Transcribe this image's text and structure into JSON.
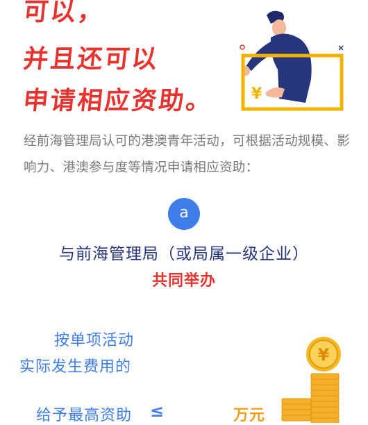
{
  "headline": {
    "line1": "可以，",
    "line2": "并且还可以",
    "line3": "申请相应资助。"
  },
  "intro": "经前海管理局认可的港澳青年活动，可根据活动规模、影响力、港澳参与度等情况申请相应资助：",
  "item_badge": "a",
  "organizers": "与前海管理局（或局属一级企业）",
  "cohost": "共同举办",
  "funding": {
    "line1": "按单项活动",
    "line2": "实际发生费用的",
    "line3": "给予最高资助",
    "symbol": "≤",
    "unit": "万元"
  },
  "icons": {
    "hero": "person-holding-yuan-card-illustration",
    "coins": "gold-yuan-coin-stack-icon",
    "card_symbol": "¥"
  },
  "colors": {
    "red": "#e8322d",
    "blue": "#3f7ee8",
    "navy": "#27357a",
    "gold": "#f0a020",
    "gray": "#7a7a7a"
  }
}
